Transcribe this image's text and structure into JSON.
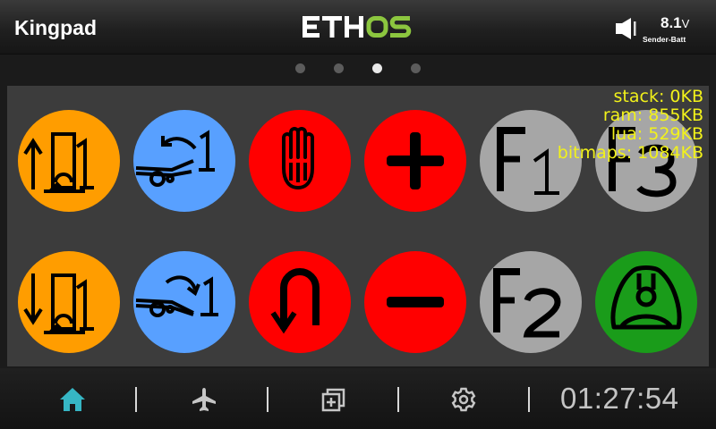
{
  "header": {
    "model_name": "Kingpad",
    "logo_text": "ETHOS",
    "battery_voltage": "8.1",
    "battery_unit": "V",
    "battery_label": "Sender-Batt",
    "speaker_icon": "speaker-icon"
  },
  "pager": {
    "pages": 4,
    "active_index": 2
  },
  "stats": {
    "stack": "stack: 0KB",
    "ram": "ram: 855KB",
    "lua": "lua: 529KB",
    "bitmaps": "bitmaps: 1084KB"
  },
  "buttons": [
    {
      "icon": "gear-up-1-icon",
      "color": "#ff9d00"
    },
    {
      "icon": "flaps-up-1-icon",
      "color": "#58a0ff"
    },
    {
      "icon": "stop-hand-icon",
      "color": "#ff0000"
    },
    {
      "icon": "plus-icon",
      "color": "#ff0000"
    },
    {
      "icon": "f1-icon",
      "color": "#a6a6a6",
      "label": "F1"
    },
    {
      "icon": "f3-icon",
      "color": "#a6a6a6",
      "label": "F3"
    },
    {
      "icon": "gear-down-1-icon",
      "color": "#ff9d00"
    },
    {
      "icon": "flaps-down-1-icon",
      "color": "#58a0ff"
    },
    {
      "icon": "u-turn-icon",
      "color": "#ff0000"
    },
    {
      "icon": "minus-icon",
      "color": "#ff0000"
    },
    {
      "icon": "f2-icon",
      "color": "#a6a6a6",
      "label": "F2"
    },
    {
      "icon": "bell-icon",
      "color": "#1a9c1a"
    }
  ],
  "footer": {
    "nav": [
      "home-icon",
      "airplane-icon",
      "layers-icon",
      "gear-icon"
    ],
    "active_nav": "home-icon",
    "accent": "#36b6c4",
    "clock": "01:27:54"
  },
  "colors": {
    "logo_eth": "#ffffff",
    "logo_os": "#8cc63f",
    "stats_text": "#f2f21a"
  }
}
